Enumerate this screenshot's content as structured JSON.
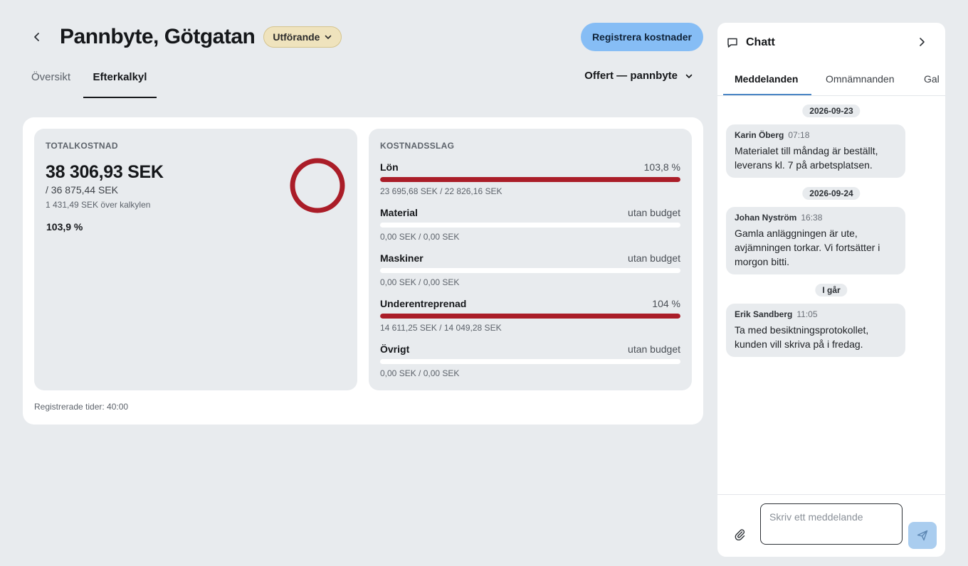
{
  "header": {
    "title": "Pannbyte, Götgatan",
    "status": "Utförande",
    "primary_action": "Registrera kostnader"
  },
  "tabs": [
    {
      "label": "Översikt"
    },
    {
      "label": "Efterkalkyl"
    }
  ],
  "offer_select": {
    "value": "Offert — pannbyte"
  },
  "total": {
    "label": "TOTALKOSTNAD",
    "amount": "38 306,93 SEK",
    "budget": "/ 36 875,44 SEK",
    "over": "1 431,49 SEK över kalkylen",
    "percent": "103,9 %",
    "progress_fraction": 1.039,
    "ring_color": "#aa1d28"
  },
  "cost_types": {
    "label": "KOSTNADSSLAG",
    "items": [
      {
        "name": "Lön",
        "percent": "103,8 %",
        "amounts": "23 695,68 SEK / 22 826,16 SEK",
        "fill": 1.0
      },
      {
        "name": "Material",
        "percent": "utan budget",
        "amounts": "0,00 SEK / 0,00 SEK",
        "fill": 0
      },
      {
        "name": "Maskiner",
        "percent": "utan budget",
        "amounts": "0,00 SEK / 0,00 SEK",
        "fill": 0
      },
      {
        "name": "Underentreprenad",
        "percent": "104 %",
        "amounts": "14 611,25 SEK / 14 049,28 SEK",
        "fill": 1.0
      },
      {
        "name": "Övrigt",
        "percent": "utan budget",
        "amounts": "0,00 SEK / 0,00 SEK",
        "fill": 0
      }
    ]
  },
  "registered_times": "Registrerade tider: 40:00",
  "chat": {
    "title": "Chatt",
    "tabs": [
      "Meddelanden",
      "Omnämnanden",
      "Gal"
    ],
    "dates": [
      "2026-09-23",
      "2026-09-24",
      "I går"
    ],
    "messages": [
      {
        "author": "Karin Öberg",
        "time": "07:18",
        "text": "Materialet till måndag är beställt, leverans kl. 7 på arbetsplatsen."
      },
      {
        "author": "Johan Nyström",
        "time": "16:38",
        "text": "Gamla anläggningen är ute, avjämningen torkar. Vi fortsätter i morgon bitti."
      },
      {
        "author": "Erik Sandberg",
        "time": "11:05",
        "text": "Ta med besiktningsprotokollet, kunden vill skriva på i fredag."
      }
    ],
    "input_placeholder": "Skriv ett meddelande"
  },
  "colors": {
    "accent": "#86bdf5",
    "over_budget": "#aa1d28",
    "status_pill": "#efe3bd",
    "background": "#e8ebee"
  }
}
